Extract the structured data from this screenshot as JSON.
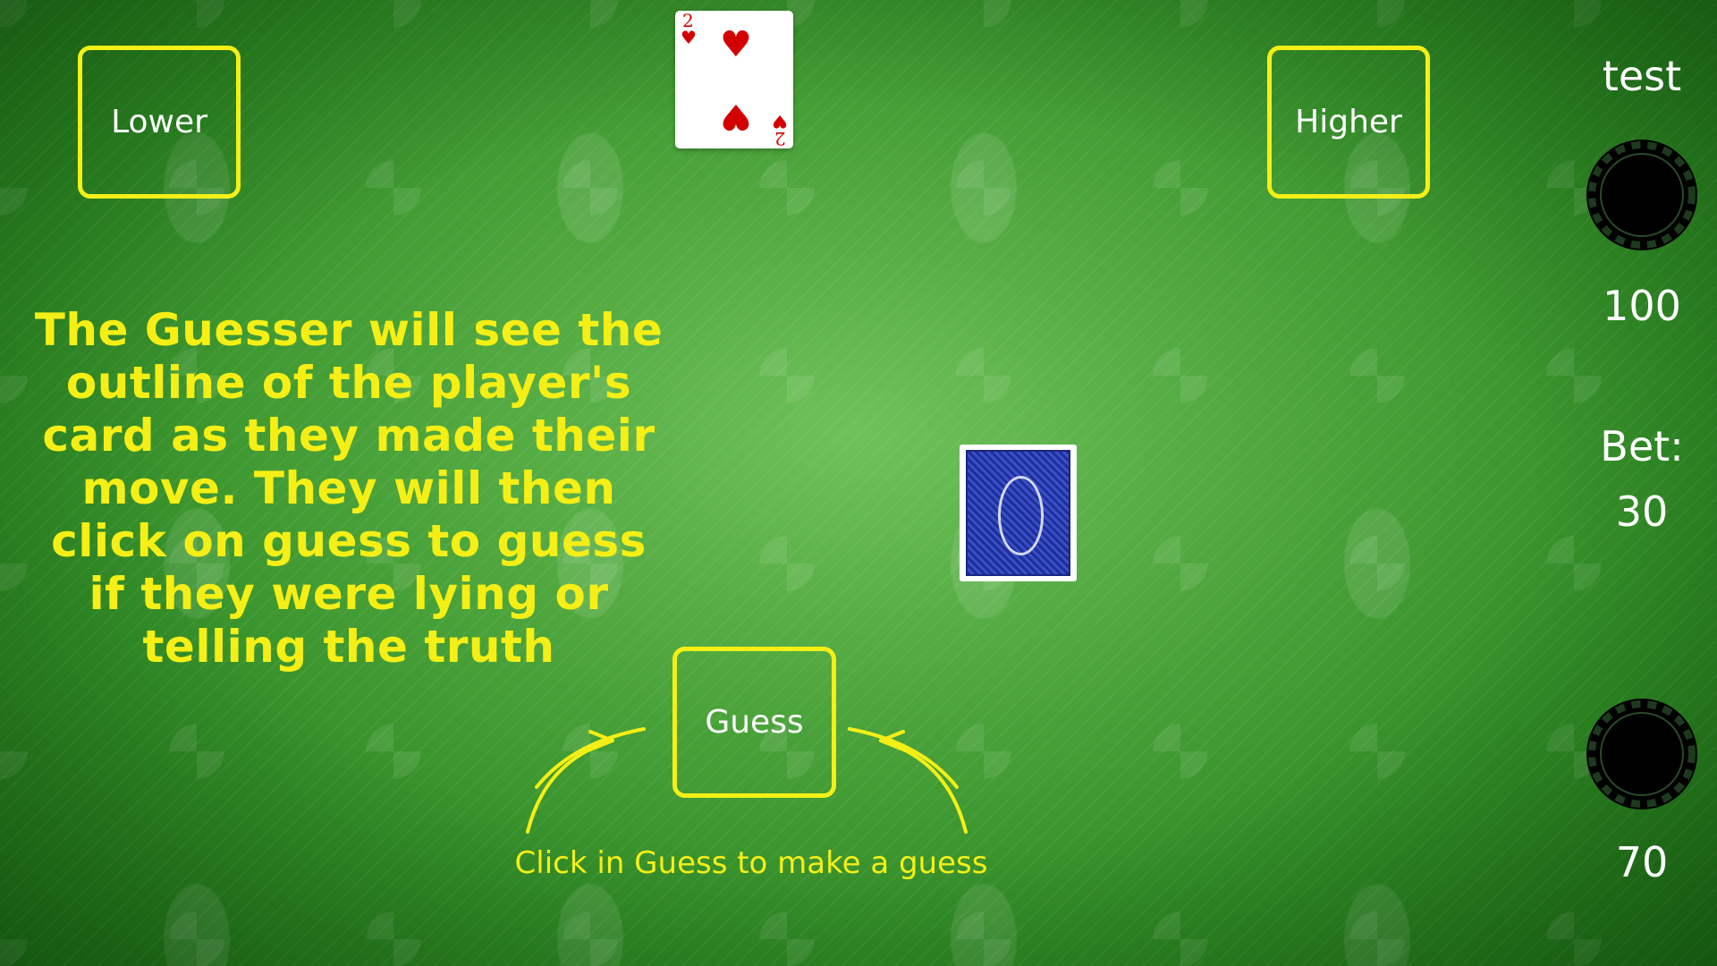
{
  "buttons": {
    "lower_label": "Lower",
    "higher_label": "Higher",
    "guess_label": "Guess"
  },
  "current_card": {
    "rank": "2",
    "suit": "♥",
    "suit_name": "hearts",
    "color": "#d40000"
  },
  "player_card": {
    "face": "down",
    "back_color": "#1e2f9a"
  },
  "instructions": "The Guesser will see the outline of the player's card as they made their move. They will then click on guess to guess if they were lying or telling the truth",
  "hint": "Click in Guess to make a guess",
  "sidebar": {
    "player_name": "test",
    "balance": "100",
    "bet_label": "Bet:",
    "bet_value": "30",
    "opponent_balance": "70"
  },
  "colors": {
    "accent": "#f5ef16",
    "table": "#4ea63d",
    "text": "#ffffff"
  },
  "icons": [
    "poker-chip-icon",
    "curved-arrow-icon"
  ]
}
